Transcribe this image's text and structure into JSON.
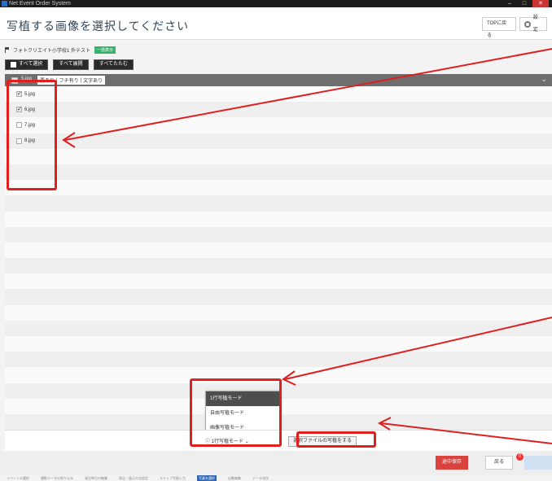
{
  "app": {
    "window_title": "Net Event Order System"
  },
  "header": {
    "title": "写植する画像を選択してください",
    "top_button": "TOPに戻る",
    "settings_button": "設定"
  },
  "breadcrumb": {
    "text": "フォトクリエイト小学校1 外テスト",
    "badge": "一括表示"
  },
  "actions": {
    "select_all": "すべて選択",
    "expand_all": "すべて展開",
    "collapse_all": "すべてたたむ"
  },
  "folder": {
    "name": "5.jpg",
    "tags": [
      "要あり",
      "フチ有り",
      "文字あり"
    ]
  },
  "files": [
    {
      "name": "5.jpg",
      "checked": true
    },
    {
      "name": "6.jpg",
      "checked": true
    },
    {
      "name": "7.jpg",
      "checked": false
    },
    {
      "name": "8.jpg",
      "checked": false
    }
  ],
  "mode_menu": {
    "options": [
      "1行写植モード",
      "自由写植モード",
      "画像写植モード"
    ],
    "selected": "1行写植モード"
  },
  "run_button": "選択ファイルの写植をする",
  "footer": {
    "save": "途中保存",
    "back": "戻る",
    "notification_count": "0"
  },
  "steps": [
    "イベントの選択",
    "撮影データの取り込み",
    "発注単位の編集",
    "商品・展示方法設定",
    "ステップ写植入力",
    "写真を選択",
    "自動編集",
    "データ送信"
  ],
  "colors": {
    "annotation": "#e01f1f",
    "save": "#d9423d",
    "badge": "#34b36a"
  }
}
